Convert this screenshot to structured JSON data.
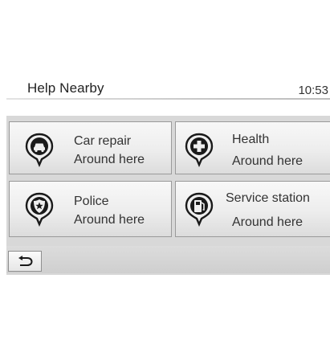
{
  "header": {
    "title": "Help Nearby",
    "time": "10:53"
  },
  "tiles": [
    {
      "name": "Car repair",
      "sub": "Around here",
      "icon": "car-repair-icon"
    },
    {
      "name": "Health",
      "sub": "Around here",
      "icon": "health-cross-icon"
    },
    {
      "name": "Police",
      "sub": "Around here",
      "icon": "police-badge-icon"
    },
    {
      "name": "Service station",
      "sub": "Around here",
      "icon": "fuel-pump-icon"
    }
  ],
  "footer": {
    "back_icon": "back-arrow-icon"
  }
}
